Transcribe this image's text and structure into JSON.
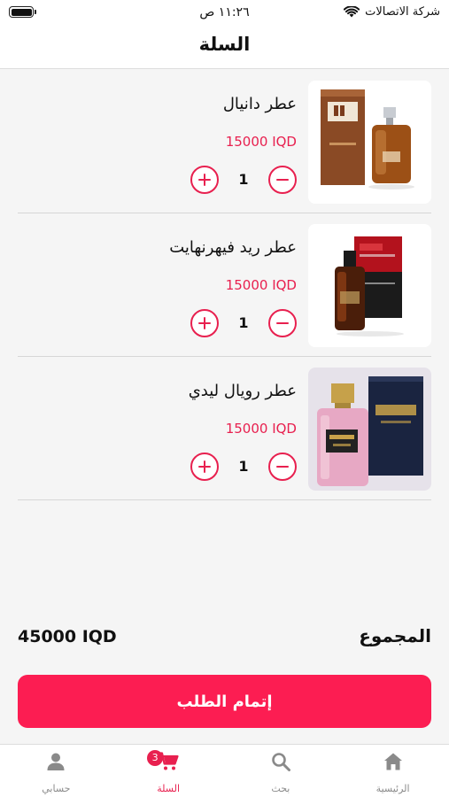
{
  "status_bar": {
    "carrier": "شركة الاتصالات",
    "time": "١١:٢٦ ص"
  },
  "header": {
    "title": "السلة"
  },
  "cart": {
    "items": [
      {
        "name": "عطر دانيال",
        "price": "15000 IQD",
        "quantity": "1",
        "image": "dunhill-perfume-bottle"
      },
      {
        "name": "عطر ريد فيهرنهايت",
        "price": "15000 IQD",
        "quantity": "1",
        "image": "red-perfume-bottle"
      },
      {
        "name": "عطر رويال ليدي",
        "price": "15000 IQD",
        "quantity": "1",
        "image": "royal-lady-perfume-bottle"
      }
    ]
  },
  "summary": {
    "total_label": "المجموع",
    "total_value": "45000 IQD"
  },
  "checkout": {
    "label": "إتمام الطلب"
  },
  "tab_bar": {
    "tabs": [
      {
        "label": "الرئيسية",
        "icon": "home-icon"
      },
      {
        "label": "بحث",
        "icon": "search-icon"
      },
      {
        "label": "السلة",
        "icon": "cart-icon",
        "badge": "3"
      },
      {
        "label": "حسابي",
        "icon": "user-icon"
      }
    ]
  },
  "colors": {
    "accent": "#e8204f",
    "checkout_button": "#fc1d52",
    "inactive_tab": "#8a8a8a"
  }
}
